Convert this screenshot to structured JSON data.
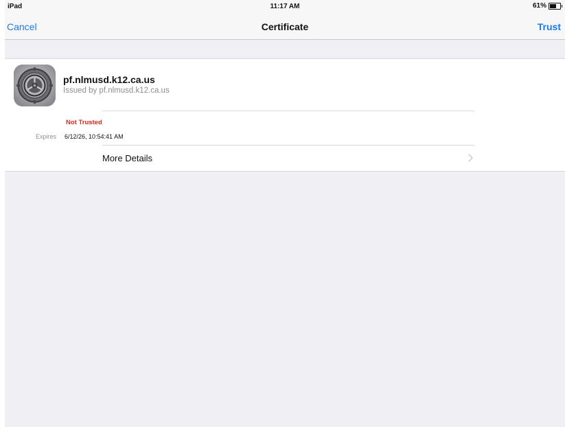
{
  "status_bar": {
    "device": "iPad",
    "time": "11:17 AM",
    "battery": "61%",
    "battery_level": 0.61
  },
  "nav": {
    "cancel_label": "Cancel",
    "title": "Certificate",
    "trust_label": "Trust"
  },
  "certificate": {
    "icon": "settings-gear-icon",
    "name": "pf.nlmusd.k12.ca.us",
    "issuer": "Issued by pf.nlmusd.k12.ca.us",
    "status": "Not Trusted",
    "expires_label": "Expires",
    "expires_value": "6/12/26, 10:54:41 AM",
    "more_details_label": "More Details"
  },
  "colors": {
    "accent": "#1a7bf0",
    "warning": "#e0261b",
    "secondary_text": "#8e8e93",
    "background": "#efeff4"
  }
}
